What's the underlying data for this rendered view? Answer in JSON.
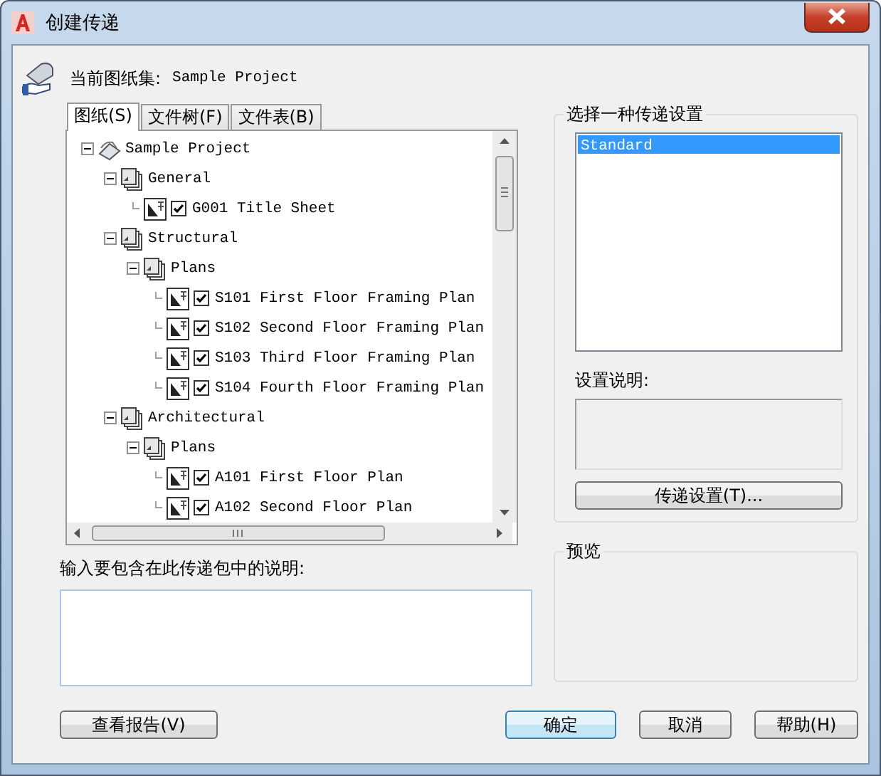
{
  "window": {
    "title": "创建传递"
  },
  "current_set": {
    "label": "当前图纸集:",
    "value": "Sample Project"
  },
  "tabs": [
    {
      "label": "图纸(S)",
      "selected": true
    },
    {
      "label": "文件树(F)",
      "selected": false
    },
    {
      "label": "文件表(B)",
      "selected": false
    }
  ],
  "tree": [
    {
      "kind": "sheetset",
      "label": "Sample Project",
      "expanded": true,
      "children": [
        {
          "kind": "subset",
          "label": "General",
          "expanded": true,
          "children": [
            {
              "kind": "sheet",
              "label": "G001 Title Sheet",
              "checked": true
            }
          ]
        },
        {
          "kind": "subset",
          "label": "Structural",
          "expanded": true,
          "children": [
            {
              "kind": "subset",
              "label": "Plans",
              "expanded": true,
              "children": [
                {
                  "kind": "sheet",
                  "label": "S101 First Floor Framing Plan",
                  "checked": true
                },
                {
                  "kind": "sheet",
                  "label": "S102 Second Floor Framing Plan",
                  "checked": true
                },
                {
                  "kind": "sheet",
                  "label": "S103 Third Floor Framing Plan",
                  "checked": true
                },
                {
                  "kind": "sheet",
                  "label": "S104 Fourth Floor Framing Plan",
                  "checked": true
                }
              ]
            }
          ]
        },
        {
          "kind": "subset",
          "label": "Architectural",
          "expanded": true,
          "children": [
            {
              "kind": "subset",
              "label": "Plans",
              "expanded": true,
              "children": [
                {
                  "kind": "sheet",
                  "label": "A101 First Floor Plan",
                  "checked": true
                },
                {
                  "kind": "sheet",
                  "label": "A102 Second Floor Plan",
                  "checked": true
                }
              ]
            }
          ]
        }
      ]
    }
  ],
  "notes_label": "输入要包含在此传递包中的说明:",
  "setups": {
    "title": "选择一种传递设置",
    "items": [
      {
        "label": "Standard",
        "selected": true
      }
    ],
    "description_label": "设置说明:",
    "button": "传递设置(T)..."
  },
  "preview": {
    "title": "预览"
  },
  "buttons": [
    {
      "label": "查看报告(V)",
      "default": false
    },
    {
      "label": "确定",
      "default": true
    },
    {
      "label": "取消",
      "default": false
    },
    {
      "label": "帮助(H)",
      "default": false
    }
  ]
}
